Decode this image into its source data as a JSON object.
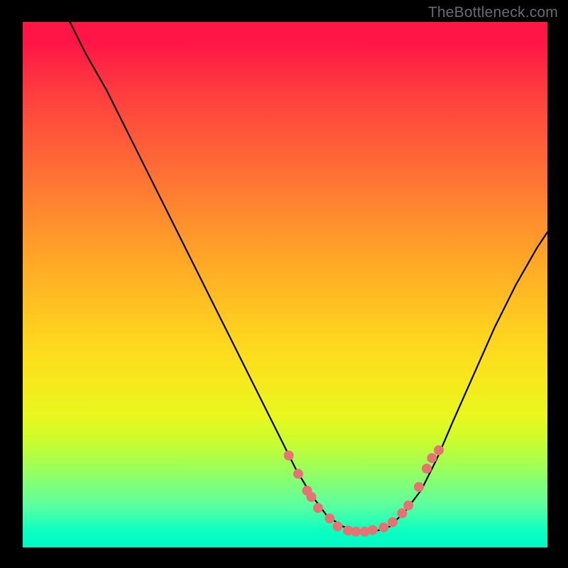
{
  "watermark": "TheBottleneck.com",
  "chart_data": {
    "type": "line",
    "title": "",
    "xlabel": "",
    "ylabel": "",
    "xlim": [
      0,
      100
    ],
    "ylim": [
      0,
      100
    ],
    "grid": false,
    "legend": false,
    "x": [
      9,
      12,
      16,
      20,
      24,
      28,
      32,
      36,
      40,
      44,
      47,
      50,
      52,
      55,
      58,
      61,
      64,
      67,
      70,
      73,
      76,
      79,
      82,
      86,
      90,
      94,
      98,
      100
    ],
    "y": [
      100,
      94,
      87,
      79,
      71,
      63,
      55,
      47,
      39,
      31,
      25,
      19,
      15,
      10,
      6,
      4,
      3,
      3,
      4,
      7,
      11,
      17,
      24,
      33,
      42,
      50,
      57,
      60
    ],
    "markers": {
      "x": [
        50.7,
        52.5,
        54.2,
        55.0,
        56.3,
        58.5,
        60.0,
        62.0,
        63.5,
        65.2,
        66.7,
        68.8,
        70.5,
        72.3,
        73.5,
        75.5,
        77.0,
        78.0,
        79.3
      ],
      "y": [
        17.5,
        14.0,
        10.8,
        9.6,
        7.5,
        5.5,
        4.0,
        3.2,
        3.0,
        3.0,
        3.3,
        3.8,
        4.8,
        6.5,
        8.0,
        11.5,
        15.0,
        17.0,
        18.5
      ],
      "color": "#e57373",
      "radius": 7
    },
    "colors": {
      "curve": "#000000",
      "gradient_top": "#ff1647",
      "gradient_mid": "#ffd41e",
      "gradient_bottom": "#00f7c7"
    }
  }
}
